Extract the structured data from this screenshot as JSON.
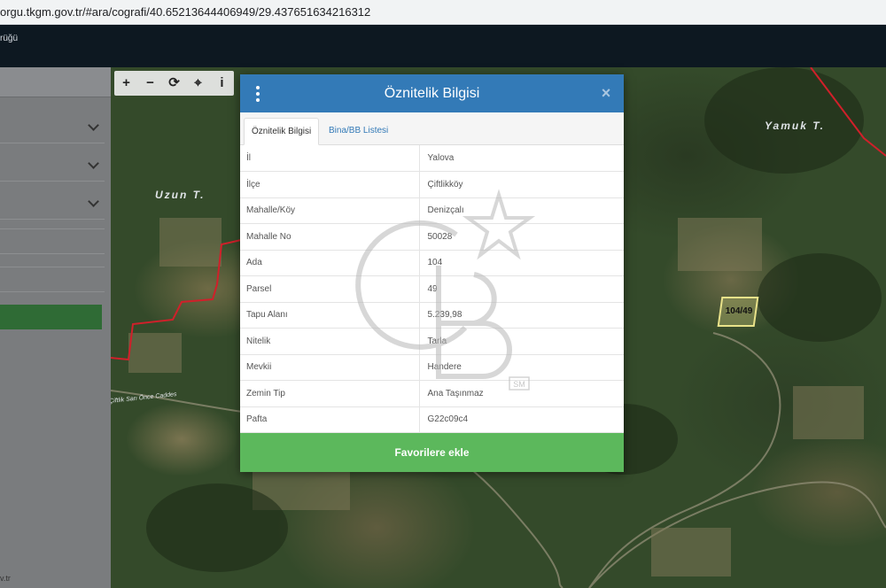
{
  "browser": {
    "url": "orgu.tkgm.gov.tr/#ara/cografi/40.65213644406949/29.437651634216312"
  },
  "app": {
    "brand_fragment": "rüğü"
  },
  "sidepanel": {
    "footer_fragment": "v.tr"
  },
  "map": {
    "tools": [
      {
        "name": "zoom-in-icon",
        "glyph": "+"
      },
      {
        "name": "zoom-out-icon",
        "glyph": "−"
      },
      {
        "name": "refresh-icon",
        "glyph": "⟳"
      },
      {
        "name": "locate-icon",
        "glyph": "⌖"
      },
      {
        "name": "info-icon",
        "glyph": "i"
      }
    ],
    "labels": {
      "uzun": "Uzun T.",
      "yamuk": "Yamuk T.",
      "road": "Çiftlik Sarı Önce Caddes"
    },
    "parcel_label": "104/49",
    "boundary_color": "#d0202a"
  },
  "modal": {
    "title": "Öznitelik Bilgisi",
    "close_glyph": "×",
    "tabs": {
      "active": "Öznitelik Bilgisi",
      "inactive": "Bina/BB Listesi"
    },
    "rows": [
      {
        "key": "İl",
        "value": "Yalova"
      },
      {
        "key": "İlçe",
        "value": "Çiftlikköy"
      },
      {
        "key": "Mahalle/Köy",
        "value": "Denizçalı"
      },
      {
        "key": "Mahalle No",
        "value": "50028"
      },
      {
        "key": "Ada",
        "value": "104"
      },
      {
        "key": "Parsel",
        "value": "49"
      },
      {
        "key": "Tapu Alanı",
        "value": "5.239,98"
      },
      {
        "key": "Nitelik",
        "value": "Tarla"
      },
      {
        "key": "Mevkii",
        "value": "Handere"
      },
      {
        "key": "Zemin Tip",
        "value": "Ana Taşınmaz"
      },
      {
        "key": "Pafta",
        "value": "G22c09c4"
      }
    ],
    "favorite_button": "Favorilere ekle",
    "header_color": "#337ab7",
    "button_color": "#5cb85c"
  },
  "watermark": {
    "mark": "SM",
    "logo": "CB star logo"
  }
}
